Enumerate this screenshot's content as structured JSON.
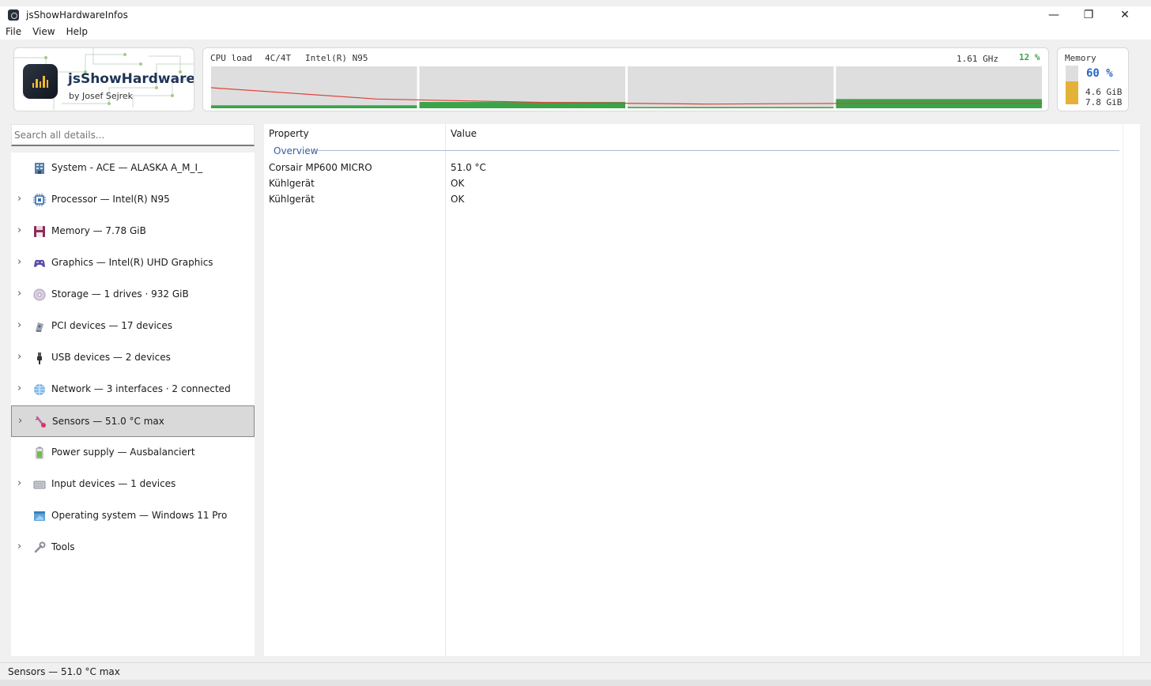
{
  "window": {
    "title": "jsShowHardwareInfos",
    "minimize": "—",
    "maximize": "❐",
    "close": "✕"
  },
  "menu": [
    "File",
    "View",
    "Help"
  ],
  "logo": {
    "title": "jsShowHardware",
    "subtitle": "by Josef Sejrek"
  },
  "cpu": {
    "label": "CPU load",
    "cores": "4C/4T",
    "name": "Intel(R) N95",
    "freq": "1.61 GHz",
    "load": "12 %",
    "core_loads": [
      0.07,
      0.15,
      0.03,
      0.22
    ],
    "history": [
      0.49,
      0.22,
      0.14,
      0.1,
      0.12,
      0.12
    ],
    "colors": {
      "bar": "#3aa44a",
      "line": "#e0403a",
      "bg": "#dedede"
    }
  },
  "memory": {
    "label": "Memory",
    "percent": "60 %",
    "used": "4.6 GiB",
    "total": "7.8 GiB",
    "fill_fraction": 0.6
  },
  "search": {
    "placeholder": "Search all details..."
  },
  "tree": [
    {
      "name": "system",
      "label": "System - ACE  —  ALASKA A_M_I_",
      "icon": "building-icon",
      "expandable": false
    },
    {
      "name": "processor",
      "label": "Processor  —  Intel(R) N95",
      "icon": "cpu-chip-icon",
      "expandable": true
    },
    {
      "name": "memory",
      "label": "Memory  —  7.78 GiB",
      "icon": "floppy-disk-icon",
      "expandable": true
    },
    {
      "name": "graphics",
      "label": "Graphics  —  Intel(R) UHD Graphics",
      "icon": "gamepad-icon",
      "expandable": true
    },
    {
      "name": "storage",
      "label": "Storage  —  1 drives · 932 GiB",
      "icon": "disc-icon",
      "expandable": true
    },
    {
      "name": "pci-devices",
      "label": "PCI devices  —  17 devices",
      "icon": "pci-card-icon",
      "expandable": true
    },
    {
      "name": "usb-devices",
      "label": "USB devices  —  2 devices",
      "icon": "usb-plug-icon",
      "expandable": true
    },
    {
      "name": "network",
      "label": "Network  —  3 interfaces · 2 connected",
      "icon": "globe-icon",
      "expandable": true
    },
    {
      "name": "sensors",
      "label": "Sensors  —  51.0 °C max",
      "icon": "thermometer-icon",
      "expandable": true,
      "selected": true
    },
    {
      "name": "power-supply",
      "label": "Power supply  —  Ausbalanciert",
      "icon": "battery-icon",
      "expandable": false
    },
    {
      "name": "input-devices",
      "label": "Input devices  —  1 devices",
      "icon": "keyboard-icon",
      "expandable": true
    },
    {
      "name": "operating-system",
      "label": "Operating system  —  Windows 11 Pro",
      "icon": "window-icon",
      "expandable": false
    },
    {
      "name": "tools",
      "label": "Tools",
      "icon": "wrench-icon",
      "expandable": true
    }
  ],
  "details": {
    "columns": {
      "property": "Property",
      "value": "Value"
    },
    "group": "Overview",
    "collapse": "⌃",
    "rows": [
      {
        "property": "Corsair MP600 MICRO",
        "value": "51.0 °C"
      },
      {
        "property": "Kühlgerät",
        "value": "OK"
      },
      {
        "property": "Kühlgerät",
        "value": "OK"
      }
    ]
  },
  "status": {
    "text": "Sensors  —  51.0 °C max"
  }
}
